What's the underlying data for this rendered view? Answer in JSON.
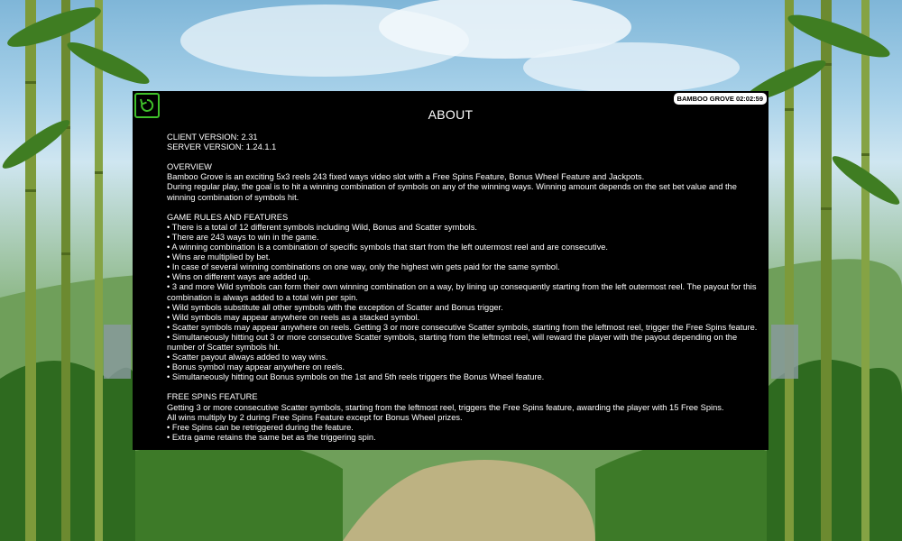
{
  "header": {
    "title": "ABOUT",
    "timer_badge": "BAMBOO GROVE 02:02:59",
    "back_icon": "back-arrow-icon",
    "accent_color": "#3fbf2a"
  },
  "versions": {
    "client": "CLIENT VERSION: 2.31",
    "server": "SERVER VERSION: 1.24.1.1"
  },
  "overview": {
    "heading": "OVERVIEW",
    "lines": [
      "Bamboo Grove is an exciting 5x3 reels 243 fixed ways video slot with a Free Spins Feature, Bonus Wheel Feature and Jackpots.",
      "During regular play, the goal is to hit a winning combination of symbols on any of the winning ways. Winning amount depends on the set bet value and the winning combination of symbols hit."
    ]
  },
  "rules": {
    "heading": "GAME RULES AND FEATURES",
    "items": [
      "• There is a total of 12 different symbols including Wild, Bonus and Scatter symbols.",
      "• There are 243 ways to win in the game.",
      "• A winning combination is a combination of specific symbols that start from the left outermost reel and are consecutive.",
      "• Wins are multiplied by bet.",
      "• In case of several winning combinations on one way, only the highest win gets paid for the same symbol.",
      "• Wins on different ways are added up.",
      "• 3 and more Wild symbols can form their own winning combination on a way, by lining up consequently starting from the left outermost reel. The payout for this combination is always added to a total win per spin.",
      "• Wild symbols substitute all other symbols with the exception of Scatter and Bonus trigger.",
      "• Wild symbols may appear anywhere on reels as a stacked symbol.",
      "• Scatter symbols may appear anywhere on reels. Getting 3 or more consecutive Scatter symbols, starting from the leftmost reel, trigger the Free Spins feature.",
      "• Simultaneously hitting out 3 or more consecutive Scatter symbols, starting from the leftmost reel, will reward the player with the payout depending on the number of Scatter symbols hit.",
      "• Scatter payout always added to way wins.",
      "• Bonus symbol may appear anywhere on reels.",
      "• Simultaneously hitting out Bonus symbols on the 1st and 5th reels triggers the Bonus Wheel feature."
    ]
  },
  "free_spins": {
    "heading": "FREE SPINS FEATURE",
    "lines": [
      "Getting 3 or more consecutive Scatter symbols, starting from the leftmost reel, triggers the Free Spins feature, awarding the player with 15 Free Spins.",
      "All wins multiply by 2 during Free Spins Feature except for Bonus Wheel prizes.",
      "• Free Spins can be retriggered during the feature.",
      "• Extra game retains the same bet as the triggering spin."
    ]
  }
}
